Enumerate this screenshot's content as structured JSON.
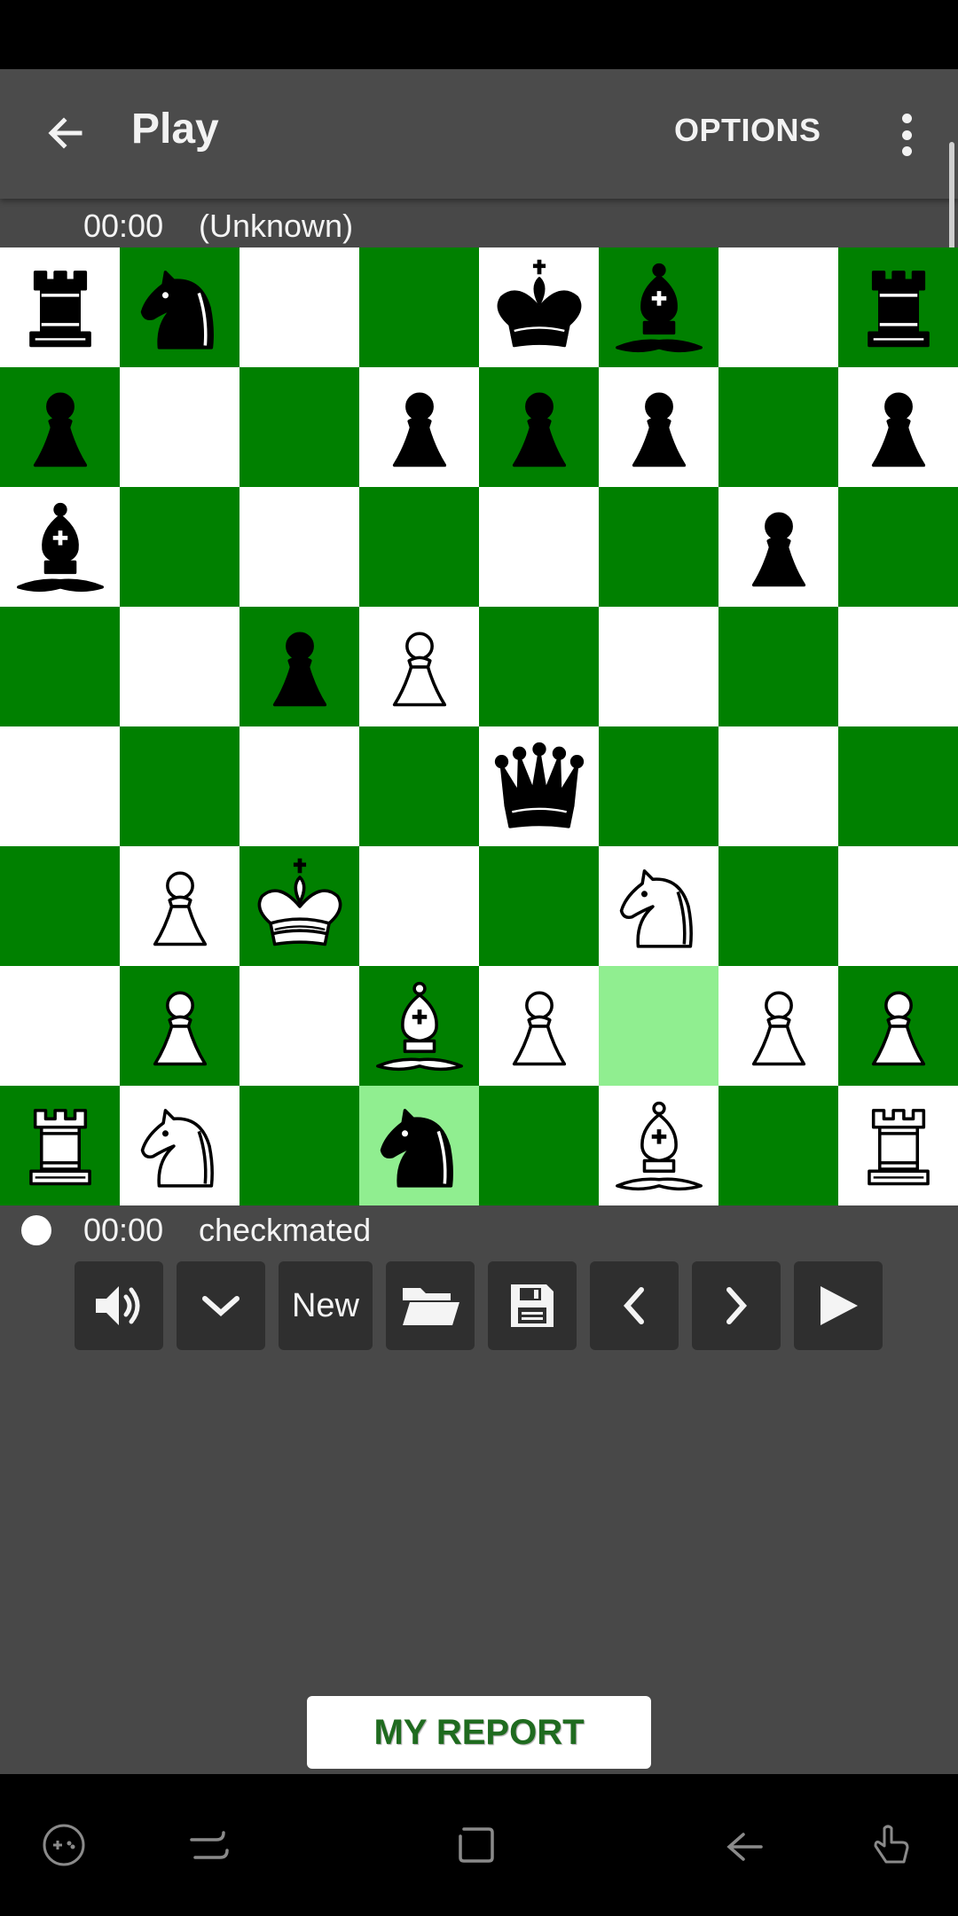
{
  "app": {
    "title": "Play",
    "options_label": "OPTIONS"
  },
  "icons": {
    "back": "arrow-left-icon",
    "overflow": "more-vertical-icon",
    "sound": "speaker-icon",
    "menu_down": "chevron-down-icon",
    "open": "folder-icon",
    "save": "floppy-disk-icon",
    "prev": "chevron-left-icon",
    "next": "chevron-right-icon",
    "play": "play-icon"
  },
  "top_player": {
    "time": "00:00",
    "name": "(Unknown)"
  },
  "bottom_player": {
    "time": "00:00",
    "status": "checkmated"
  },
  "colors": {
    "dark_square": "#008000",
    "light_square": "#ffffff",
    "highlight_square": "#90ee90",
    "report_text": "#1f6b1f"
  },
  "board": {
    "ranks": [
      [
        "br",
        "bn",
        "",
        "",
        "bk",
        "bb",
        "",
        "br"
      ],
      [
        "bp",
        "",
        "",
        "bp",
        "bp",
        "bp",
        "",
        "bp"
      ],
      [
        "bb",
        "",
        "",
        "",
        "",
        "",
        "bp",
        ""
      ],
      [
        "",
        "",
        "bp",
        "wp",
        "",
        "",
        "",
        ""
      ],
      [
        "",
        "",
        "",
        "",
        "bq",
        "",
        "",
        ""
      ],
      [
        "",
        "wp",
        "wk",
        "",
        "",
        "wn",
        "",
        ""
      ],
      [
        "",
        "wp",
        "",
        "wb",
        "wp",
        "",
        "wp",
        "wp"
      ],
      [
        "wr",
        "wn",
        "",
        "bn",
        "",
        "wb",
        "",
        "wr"
      ]
    ],
    "highlighted": [
      "f2",
      "d1"
    ]
  },
  "toolbar": {
    "new_label": "New"
  },
  "report_label": "MY REPORT"
}
